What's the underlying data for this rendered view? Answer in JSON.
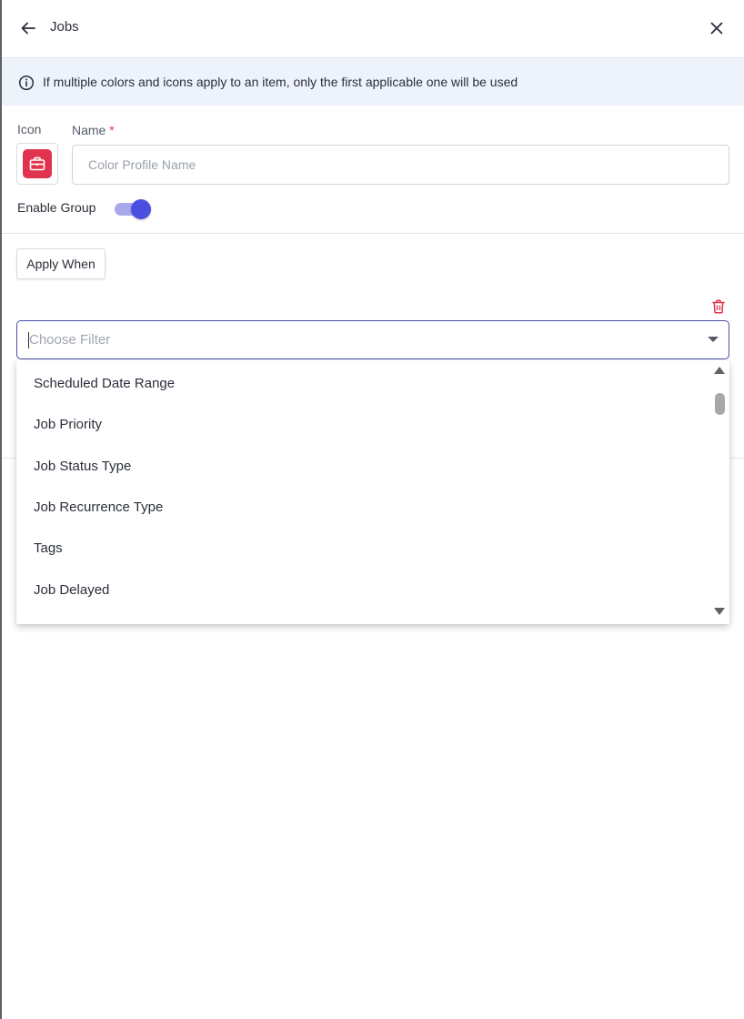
{
  "header": {
    "title": "Jobs",
    "back_icon": "arrow-left-icon",
    "close_icon": "close-icon"
  },
  "info_banner": {
    "icon": "info-icon",
    "text": "If multiple colors and icons apply to an item, only the first applicable one will be used"
  },
  "form": {
    "icon_label": "Icon",
    "selected_icon": "briefcase-icon",
    "icon_color": "#e0334e",
    "name_label": "Name",
    "name_required_marker": "*",
    "name_value": "",
    "name_placeholder": "Color Profile Name",
    "enable_group_label": "Enable Group",
    "enable_group_on": true,
    "toggle_color": "#4b4fe0"
  },
  "conditions": {
    "apply_when_label": "Apply When",
    "delete_icon": "trash-icon",
    "filter_placeholder": "Choose Filter",
    "filter_options": [
      "Scheduled Date Range",
      "Job Priority",
      "Job Status Type",
      "Job Recurrence Type",
      "Tags",
      "Job Delayed"
    ]
  }
}
